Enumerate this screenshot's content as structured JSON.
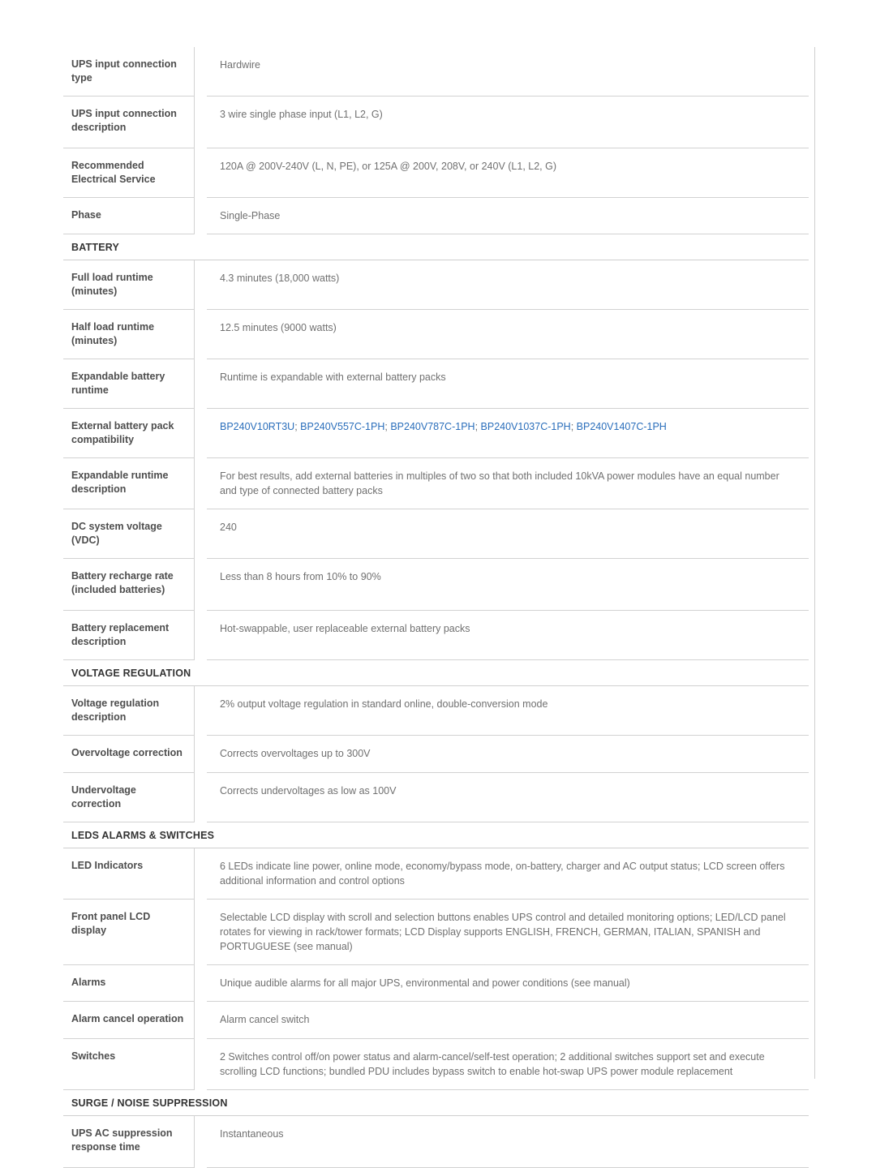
{
  "document": {
    "type": "product-specification-table",
    "columns": [
      "Specification",
      "Value"
    ]
  },
  "colors": {
    "label_text": "#4d4d4d",
    "value_text": "#707070",
    "section_text": "#333333",
    "link": "#2a6ebb",
    "border": "#d2d2d2",
    "page_rule": "#cfcfcf",
    "background": "#ffffff"
  },
  "rows": [
    {
      "kind": "spec",
      "size": "md",
      "label": "UPS input connection type",
      "value": "Hardwire"
    },
    {
      "kind": "spec",
      "size": "lg",
      "label": "UPS input connection description",
      "value": "3 wire single phase input (L1, L2, G)"
    },
    {
      "kind": "spec",
      "size": "md",
      "label": "Recommended Electrical Service",
      "value": "120A @ 200V-240V (L, N, PE), or 125A @ 200V, 208V, or 240V (L1, L2, G)"
    },
    {
      "kind": "spec",
      "size": "sm",
      "label": "Phase",
      "value": "Single-Phase"
    },
    {
      "kind": "section",
      "label": "BATTERY"
    },
    {
      "kind": "spec",
      "size": "md",
      "label": "Full load runtime (minutes)",
      "value": "4.3 minutes (18,000 watts)"
    },
    {
      "kind": "spec",
      "size": "md",
      "label": "Half load runtime (minutes)",
      "value": "12.5 minutes (9000 watts)"
    },
    {
      "kind": "spec",
      "size": "md",
      "label": "Expandable battery runtime",
      "value": "Runtime is expandable with external battery packs"
    },
    {
      "kind": "links",
      "size": "md",
      "label": "External battery pack compatibility",
      "links": [
        "BP240V10RT3U",
        "BP240V557C-1PH",
        "BP240V787C-1PH",
        "BP240V1037C-1PH",
        "BP240V1407C-1PH"
      ],
      "separator": "; "
    },
    {
      "kind": "spec",
      "size": "md",
      "label": "Expandable runtime description",
      "value": "For best results, add external batteries in multiples of two so that both included 10kVA power modules have an equal number and type of connected battery packs"
    },
    {
      "kind": "spec",
      "size": "md",
      "label": "DC system voltage (VDC)",
      "value": "240"
    },
    {
      "kind": "spec",
      "size": "lg",
      "label": "Battery recharge rate (included batteries)",
      "value": "Less than 8 hours from 10% to 90%"
    },
    {
      "kind": "spec",
      "size": "md",
      "label": "Battery replacement description",
      "value": "Hot-swappable, user replaceable external battery packs"
    },
    {
      "kind": "section",
      "label": "VOLTAGE REGULATION"
    },
    {
      "kind": "spec",
      "size": "md",
      "label": "Voltage regulation description",
      "value": "2% output voltage regulation in standard online, double-conversion mode"
    },
    {
      "kind": "spec",
      "size": "md",
      "label": "Overvoltage correction",
      "value": "Corrects overvoltages up to 300V"
    },
    {
      "kind": "spec",
      "size": "md",
      "label": "Undervoltage correction",
      "value": "Corrects undervoltages as low as 100V"
    },
    {
      "kind": "section",
      "label": "LEDS ALARMS & SWITCHES"
    },
    {
      "kind": "spec",
      "size": "md",
      "label": "LED Indicators",
      "value": "6 LEDs indicate line power, online mode, economy/bypass mode, on-battery, charger and AC output status; LCD screen offers additional information and control options"
    },
    {
      "kind": "spec",
      "size": "md",
      "label": "Front panel LCD display",
      "value": "Selectable LCD display with scroll and selection buttons enables UPS control and detailed monitoring options; LED/LCD panel rotates for viewing in rack/tower formats; LCD Display supports ENGLISH, FRENCH, GERMAN, ITALIAN, SPANISH and PORTUGUESE (see manual)"
    },
    {
      "kind": "spec",
      "size": "sm",
      "label": "Alarms",
      "value": "Unique audible alarms for all major UPS, environmental and power conditions (see manual)"
    },
    {
      "kind": "spec",
      "size": "md",
      "label": "Alarm cancel operation",
      "value": "Alarm cancel switch"
    },
    {
      "kind": "spec",
      "size": "md",
      "label": "Switches",
      "value": "2 Switches control off/on power status and alarm-cancel/self-test operation; 2 additional switches support set and execute scrolling LCD functions; bundled PDU includes bypass switch to enable hot-swap UPS power module replacement"
    },
    {
      "kind": "section",
      "label": "SURGE / NOISE SUPPRESSION"
    },
    {
      "kind": "spec",
      "size": "lg",
      "label": "UPS AC suppression response time",
      "value": "Instantaneous"
    }
  ]
}
